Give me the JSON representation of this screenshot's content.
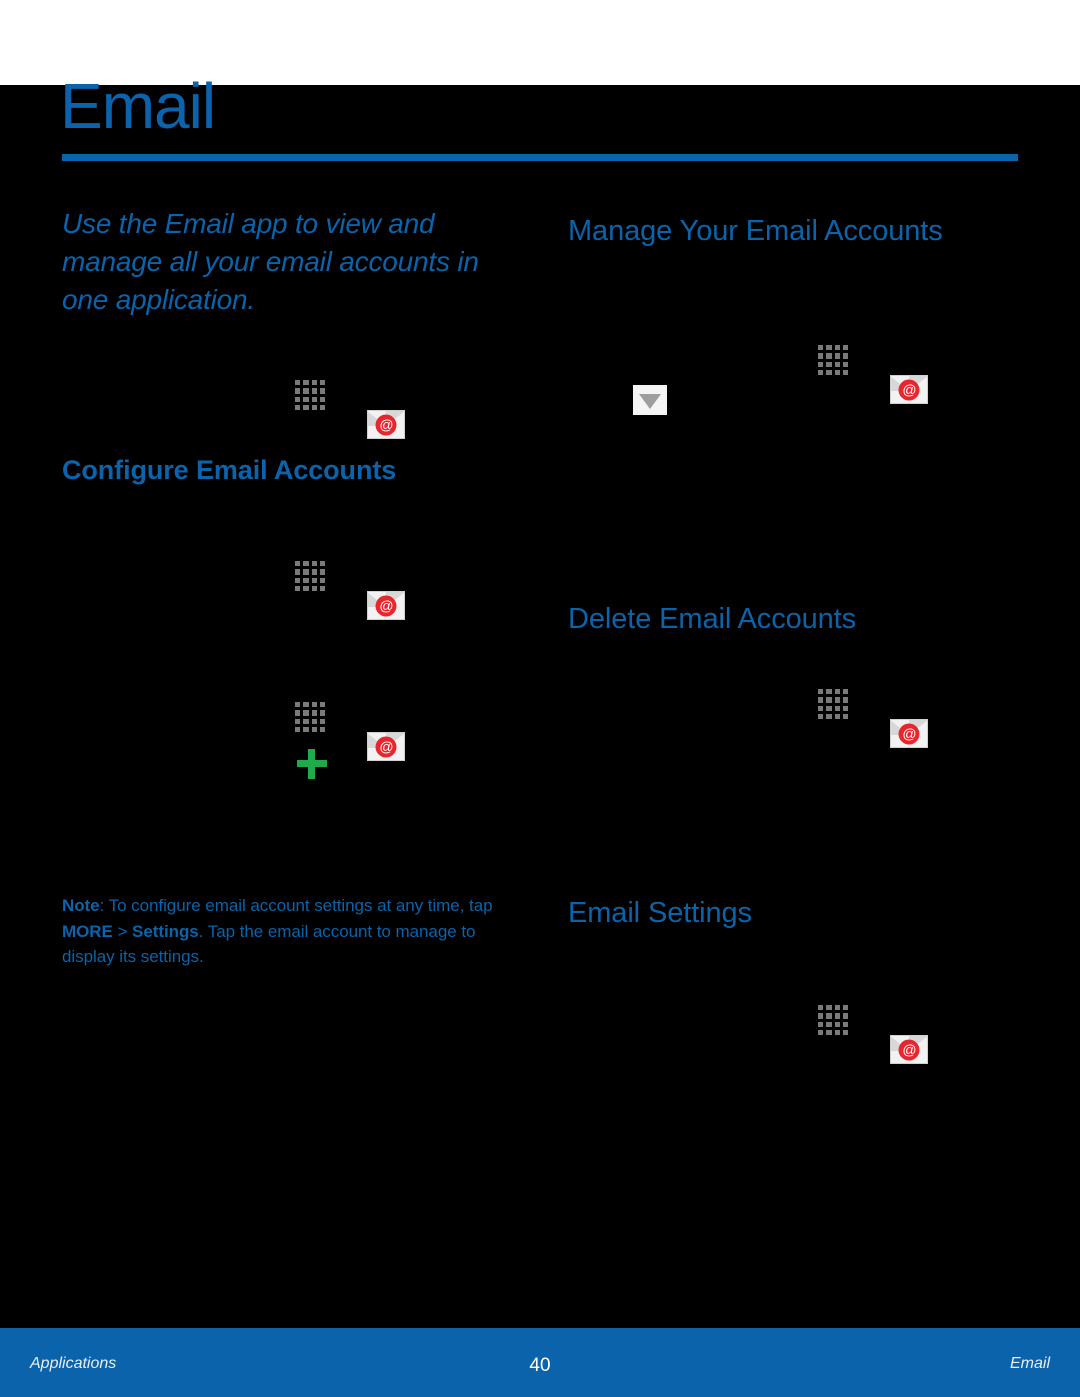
{
  "document": {
    "title": "Email",
    "accent_color": "#0a63ab",
    "background_color": "#000000"
  },
  "intro": {
    "text": "Use the Email app to view and manage all your email accounts in one application."
  },
  "sections": {
    "configure": {
      "heading": "Configure Email Accounts"
    },
    "manage": {
      "heading": "Manage Your Email Accounts"
    },
    "delete": {
      "heading": "Delete Email Accounts"
    },
    "settings": {
      "heading": "Email Settings"
    }
  },
  "note": {
    "label": "Note",
    "colon": ": ",
    "part1": "To configure email account settings at any time, tap ",
    "more": "MORE",
    "separator": " > ",
    "settings": "Settings",
    "part2": ". Tap the email account to manage to display its settings."
  },
  "icons": {
    "apps": "apps-grid-icon",
    "email": "email-envelope-icon",
    "dropdown": "dropdown-chevron-icon",
    "add": "plus-add-icon",
    "at_glyph": "@"
  },
  "footer": {
    "left": "Applications",
    "page_number": "40",
    "right": "Email"
  }
}
